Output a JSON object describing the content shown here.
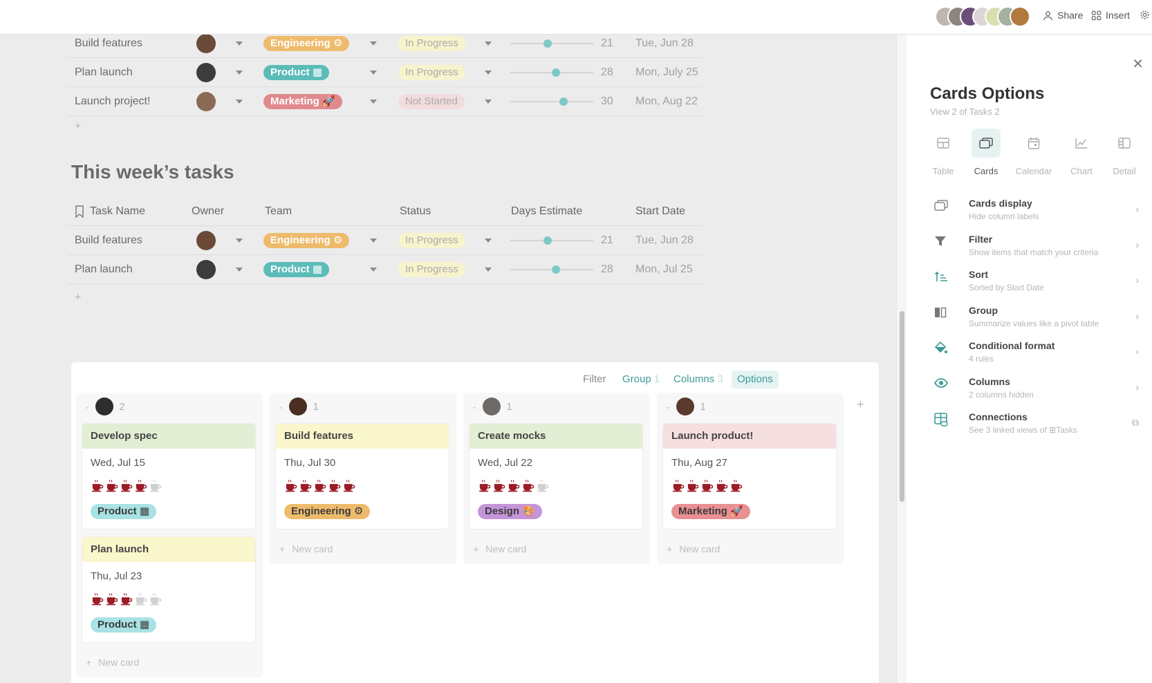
{
  "topbar": {
    "collaborator_count": 7,
    "share_label": "Share",
    "insert_label": "Insert",
    "avatar_colors": [
      "#bdb7b0",
      "#8f8580",
      "#6a4e7a",
      "#dcd6d6",
      "#d9e0b0",
      "#a4b1a2",
      "#b07a3d"
    ]
  },
  "top_table": {
    "rows": [
      {
        "task": "Build features",
        "owner_color": "#6b4a3a",
        "team": "Engineering",
        "team_icon": "⚙",
        "status": "In Progress",
        "days": 21,
        "days_fraction": 0.45,
        "start": "Tue, Jun 28"
      },
      {
        "task": "Plan launch",
        "owner_color": "#3c3c3c",
        "team": "Product",
        "team_icon": "▦",
        "status": "In Progress",
        "days": 28,
        "days_fraction": 0.55,
        "start": "Mon, July 25"
      },
      {
        "task": "Launch project!",
        "owner_color": "#8a6a55",
        "team": "Marketing",
        "team_icon": "🚀",
        "status": "Not Started",
        "days": 30,
        "days_fraction": 0.64,
        "start": "Mon, Aug 22"
      }
    ]
  },
  "week_section": {
    "title": "This week’s tasks",
    "headers": {
      "task": "Task Name",
      "owner": "Owner",
      "team": "Team",
      "status": "Status",
      "days": "Days Estimate",
      "start": "Start Date"
    },
    "rows": [
      {
        "task": "Build features",
        "owner_color": "#6b4a3a",
        "team": "Engineering",
        "team_icon": "⚙",
        "status": "In Progress",
        "days": 21,
        "days_fraction": 0.45,
        "start": "Tue, Jun 28"
      },
      {
        "task": "Plan launch",
        "owner_color": "#3c3c3c",
        "team": "Product",
        "team_icon": "▦",
        "status": "In Progress",
        "days": 28,
        "days_fraction": 0.55,
        "start": "Mon, Jul 25"
      }
    ]
  },
  "board": {
    "toolbar": {
      "filter": "Filter",
      "group": "Group",
      "group_count": "1",
      "columns": "Columns",
      "columns_count": "3",
      "options": "Options"
    },
    "new_card_label": "New card",
    "columns": [
      {
        "count": "2",
        "avatar_color": "#2e2e2e",
        "cards": [
          {
            "title": "Develop spec",
            "header_color": "#e2efd5",
            "date": "Wed, Jul 15",
            "cups_filled": 4,
            "cups_total": 5,
            "tag": "Product",
            "tag_icon": "▦",
            "tag_bg": "#a8e2e4"
          },
          {
            "title": "Plan launch",
            "header_color": "#fbf7cc",
            "date": "Thu, Jul 23",
            "cups_filled": 3,
            "cups_total": 5,
            "tag": "Product",
            "tag_icon": "▦",
            "tag_bg": "#a8e2e4"
          }
        ]
      },
      {
        "count": "1",
        "avatar_color": "#4a2e22",
        "cards": [
          {
            "title": "Build features",
            "header_color": "#fbf7cc",
            "date": "Thu, Jul 30",
            "cups_filled": 5,
            "cups_total": 5,
            "tag": "Engineering",
            "tag_icon": "⚙",
            "tag_bg": "#eebb6c"
          }
        ]
      },
      {
        "count": "1",
        "avatar_color": "#6e6a66",
        "cards": [
          {
            "title": "Create mocks",
            "header_color": "#e2efd5",
            "date": "Wed, Jul 22",
            "cups_filled": 4,
            "cups_total": 5,
            "tag": "Design",
            "tag_icon": "🎨",
            "tag_bg": "#c595d8"
          }
        ]
      },
      {
        "count": "1",
        "avatar_color": "#5a3a2c",
        "cards": [
          {
            "title": "Launch product!",
            "header_color": "#f6dfe0",
            "date": "Thu, Aug 27",
            "cups_filled": 5,
            "cups_total": 5,
            "tag": "Marketing",
            "tag_icon": "🚀",
            "tag_bg": "#e99092"
          }
        ]
      }
    ]
  },
  "panel": {
    "title": "Cards Options",
    "subtitle": "View 2 of Tasks 2",
    "view_tabs": [
      {
        "label": "Table",
        "icon": "table-icon",
        "active": false
      },
      {
        "label": "Cards",
        "icon": "cards-icon",
        "active": true
      },
      {
        "label": "Calendar",
        "icon": "calendar-icon",
        "active": false
      },
      {
        "label": "Chart",
        "icon": "chart-icon",
        "active": false
      },
      {
        "label": "Detail",
        "icon": "detail-icon",
        "active": false
      }
    ],
    "options": [
      {
        "title": "Cards display",
        "subtitle": "Hide column labels",
        "icon": "cards-display-icon"
      },
      {
        "title": "Filter",
        "subtitle": "Show items that match your criteria",
        "icon": "filter-icon"
      },
      {
        "title": "Sort",
        "subtitle": "Sorted by Start Date",
        "icon": "sort-icon"
      },
      {
        "title": "Group",
        "subtitle": "Summarize values like a pivot table",
        "icon": "group-icon"
      },
      {
        "title": "Conditional format",
        "subtitle": "4 rules",
        "icon": "paint-bucket-icon"
      },
      {
        "title": "Columns",
        "subtitle": "2 columns hidden",
        "icon": "eye-icon"
      },
      {
        "title": "Connections",
        "subtitle_prefix": "See 3 linked views of",
        "subtitle_link": "Tasks",
        "icon": "connections-icon"
      }
    ]
  },
  "colors": {
    "accent_teal": "#3d9b96",
    "team": {
      "Engineering": "#eebb6c",
      "Product": "#5bbcb8",
      "Marketing": "#e08a8c",
      "Design": "#c595d8"
    },
    "status": {
      "In Progress": "#f7f3cd",
      "Not Started": "#f3dcdd"
    },
    "cup_filled": "#9b1b26",
    "cup_empty": "#d0d0d0"
  }
}
